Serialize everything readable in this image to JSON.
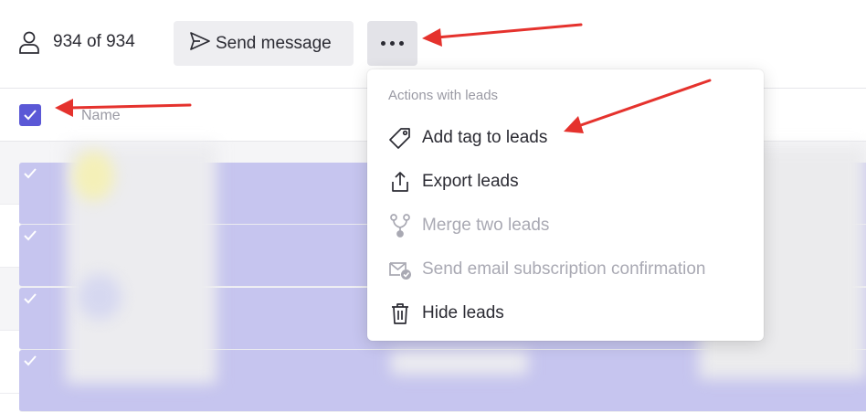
{
  "toolbar": {
    "lead_count": "934 of 934",
    "send_message_label": "Send message",
    "more_icon": "more-horizontal-icon"
  },
  "table": {
    "columns": [
      "Name"
    ],
    "select_all_checked": true,
    "row_count_visible": 4
  },
  "menu": {
    "heading": "Actions with leads",
    "items": [
      {
        "label": "Add tag to leads",
        "icon": "tag-icon",
        "enabled": true
      },
      {
        "label": "Export leads",
        "icon": "export-icon",
        "enabled": true
      },
      {
        "label": "Merge two leads",
        "icon": "merge-icon",
        "enabled": false
      },
      {
        "label": "Send email subscription confirmation",
        "icon": "email-confirm-icon",
        "enabled": false
      },
      {
        "label": "Hide leads",
        "icon": "trash-icon",
        "enabled": true
      }
    ]
  },
  "colors": {
    "accent": "#5b58d6",
    "annotation": "#e5322d"
  }
}
